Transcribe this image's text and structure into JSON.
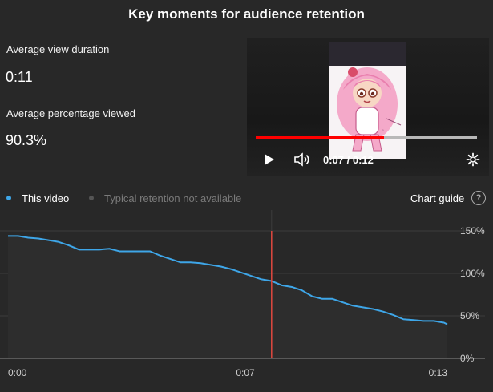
{
  "header": {
    "title": "Key moments for audience retention"
  },
  "metrics": {
    "avg_view_duration_label": "Average view duration",
    "avg_view_duration_value": "0:11",
    "avg_pct_viewed_label": "Average percentage viewed",
    "avg_pct_viewed_value": "90.3%"
  },
  "player": {
    "time_display": "0:07 / 0:12",
    "progress_fraction": 0.58
  },
  "legend": {
    "this_video": "This video",
    "typical": "Typical retention not available",
    "chart_guide": "Chart guide",
    "this_video_color": "#3ea6e8",
    "typical_color": "#555555"
  },
  "chart_data": {
    "type": "line",
    "title": "",
    "xlabel": "",
    "ylabel": "",
    "x_tick_labels": [
      "0:00",
      "0:07",
      "0:13"
    ],
    "y_tick_labels": [
      "150%",
      "100%",
      "50%",
      "0%"
    ],
    "ylim": [
      0,
      150
    ],
    "xlim": [
      0,
      13
    ],
    "grid": true,
    "marker_x": 7.8,
    "series": [
      {
        "name": "This video",
        "color": "#3ea6e8",
        "x": [
          0,
          0.3,
          0.6,
          0.9,
          1.2,
          1.5,
          1.8,
          2.1,
          2.4,
          2.7,
          3.0,
          3.3,
          3.6,
          3.9,
          4.2,
          4.5,
          4.8,
          5.1,
          5.4,
          5.7,
          6.0,
          6.3,
          6.6,
          6.9,
          7.2,
          7.5,
          7.8,
          8.1,
          8.4,
          8.7,
          9.0,
          9.3,
          9.6,
          9.9,
          10.2,
          10.5,
          10.8,
          11.1,
          11.4,
          11.7,
          12.0,
          12.3,
          12.6,
          12.9,
          13.0
        ],
        "y": [
          144,
          144,
          142,
          141,
          139,
          137,
          133,
          128,
          128,
          128,
          129,
          126,
          126,
          126,
          126,
          121,
          117,
          113,
          113,
          112,
          110,
          108,
          105,
          101,
          97,
          93,
          91,
          86,
          84,
          80,
          73,
          70,
          70,
          66,
          62,
          60,
          58,
          55,
          51,
          46,
          45,
          44,
          44,
          42,
          40
        ]
      }
    ]
  }
}
